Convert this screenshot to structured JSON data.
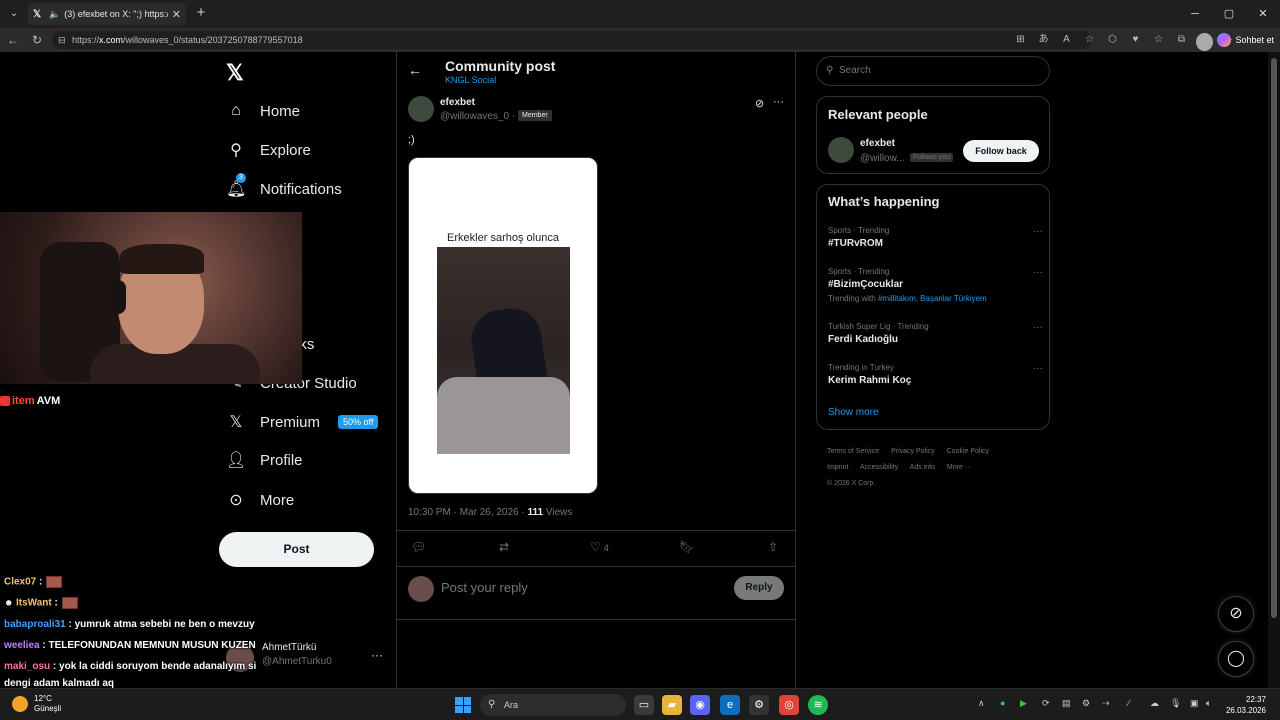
{
  "browser": {
    "tab_title": "(3) efexbet on X: \";) https://t.co",
    "url_host": "x.com",
    "url_path": "/willowaves_0/status/2037250788779557018",
    "url_prefix": "https://",
    "copilot_label": "Sohbet et"
  },
  "nav": {
    "items": [
      {
        "label": "Home",
        "icon": "home-icon"
      },
      {
        "label": "Explore",
        "icon": "search-icon"
      },
      {
        "label": "Notifications",
        "icon": "bell-icon",
        "badge": "3"
      },
      {
        "label": "arks",
        "icon": "bookmark-icon"
      },
      {
        "label": "Creator Studio",
        "icon": "creator-studio-icon"
      },
      {
        "label": "Premium",
        "icon": "x-icon",
        "badge": "50% off"
      },
      {
        "label": "Profile",
        "icon": "person-icon"
      },
      {
        "label": "More",
        "icon": "more-circle-icon"
      }
    ],
    "post_button": "Post",
    "account": {
      "name": "AhmetTürkü",
      "handle": "@AhmetTurku0"
    }
  },
  "stream": {
    "brand_part1": "item",
    "brand_part2": "AVM",
    "chat": [
      {
        "user": "Clex07",
        "text": " :",
        "user_color": "#f0c36b"
      },
      {
        "user": "ItsWant",
        "text": " :",
        "user_color": "#f0c36b"
      },
      {
        "user": "babaproali31",
        "text": " : yumruk atma sebebi ne ben o mevzuy",
        "user_color": "#3fa0ff"
      },
      {
        "user": "weeliea",
        "text": " : TELEFONUNDAN MEMNUN MUSUN KUZEN",
        "user_color": "#c47dff"
      },
      {
        "user": "maki_osu",
        "text": " : yok la ciddi soruyom bende adanalıyım si",
        "user_color": "#ff6fb0"
      },
      {
        "user": "",
        "text": "dengi adam kalmadı aq",
        "user_color": "#fff"
      }
    ]
  },
  "header": {
    "title": "Community post",
    "subtitle": "KNGL Social"
  },
  "post": {
    "author_name": "efexbet",
    "author_handle": "@willowaves_0 ·",
    "member_badge": "Member",
    "text": ";)",
    "media_caption": "Erkekler sarhoş olunca",
    "time": "10:30 PM · Mar 26, 2026 ·",
    "views": "111",
    "views_label": "Views",
    "likes": "4"
  },
  "reply": {
    "placeholder": "Post your reply",
    "button": "Reply"
  },
  "sidebar": {
    "search_placeholder": "Search",
    "relevant_title": "Relevant people",
    "person": {
      "name": "efexbet",
      "handle": "@willow...",
      "follows_you": "Follows you",
      "button": "Follow back"
    },
    "happening_title": "What’s happening",
    "trends": [
      {
        "context": "Sports · Trending",
        "title": "#TURvROM"
      },
      {
        "context": "Sports · Trending",
        "title": "#BizimÇocuklar",
        "sub_prefix": "Trending with ",
        "sub_links": "#millitakım, Başanlar Türkiyem"
      },
      {
        "context": "Turkish Super Lig · Trending",
        "title": "Ferdi Kadıoğlu"
      },
      {
        "context": "Trending in Turkey",
        "title": "Kerim Rahmi Koç"
      }
    ],
    "show_more": "Show more",
    "footer_line1": [
      "Terms of Service",
      "Privacy Policy",
      "Cookie Policy"
    ],
    "footer_line2": [
      "Imprint",
      "Accessibility",
      "Ads info",
      "More ···"
    ],
    "copyright": "© 2026 X Corp."
  },
  "taskbar": {
    "temp": "12°C",
    "weather": "Güneşli",
    "search": "Ara",
    "time": "22:37",
    "date": "26.03.2026"
  },
  "colors": {
    "accent": "#1d9bf0",
    "background": "#000000",
    "border": "#2f3336"
  }
}
